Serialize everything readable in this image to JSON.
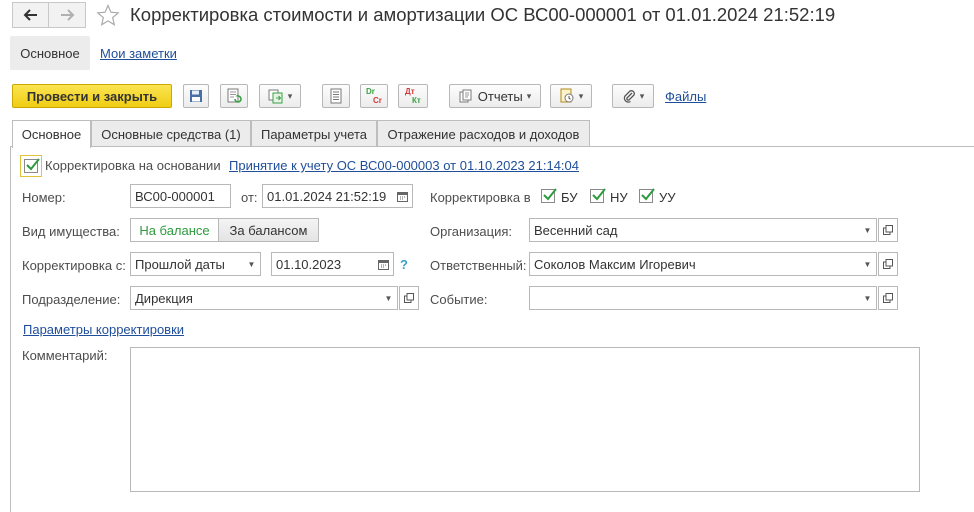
{
  "window": {
    "title": "Корректировка стоимости и амортизации ОС ВС00-000001 от 01.01.2024 21:52:19"
  },
  "icons": {
    "back": "arrow-left-icon",
    "forward": "arrow-right-icon",
    "favorite": "star-icon",
    "save": "floppy-disk-icon",
    "refresh": "refresh-document-icon",
    "create_based": "create-based-on-icon",
    "document_list": "list-icon",
    "dt_ct": "dt-ct-icon",
    "dr_cr": "dr-cr-icon",
    "reports": "reports-icon",
    "attachments": "paperclip-icon",
    "calendar": "calendar-icon",
    "help": "question-icon",
    "open": "open-window-icon"
  },
  "sections": {
    "main": "Основное",
    "notes": "Мои заметки"
  },
  "toolbar": {
    "post_close": "Провести и закрыть",
    "reports": "Отчеты",
    "files": "Файлы",
    "dr_top": "Dr",
    "dr_bottom": "Cr",
    "dt_top": "Дт",
    "dt_bottom": "Кт"
  },
  "tabs": [
    {
      "label": "Основное",
      "active": true
    },
    {
      "label": "Основные средства (1)",
      "active": false
    },
    {
      "label": "Параметры учета",
      "active": false
    },
    {
      "label": "Отражение расходов и доходов",
      "active": false
    }
  ],
  "form": {
    "basis_label": "Корректировка на основании",
    "basis_checked": true,
    "basis_link": "Принятие к учету ОС ВС00-000003 от 01.10.2023 21:14:04",
    "number_label": "Номер:",
    "number_value": "ВС00-000001",
    "date_label": "от:",
    "date_value": "01.01.2024 21:52:19",
    "correction_in_label": "Корректировка в",
    "bu_label": "БУ",
    "nu_label": "НУ",
    "uu_label": "УУ",
    "bu_checked": true,
    "nu_checked": true,
    "uu_checked": true,
    "property_label": "Вид имущества:",
    "on_balance": "На балансе",
    "off_balance": "За балансом",
    "selected_property": "На балансе",
    "org_label": "Организация:",
    "org_value": "Весенний сад",
    "correction_from_label": "Корректировка с:",
    "correction_from_value": "Прошлой даты",
    "correction_date": "01.10.2023",
    "help_mark": "?",
    "responsible_label": "Ответственный:",
    "responsible_value": "Соколов Максим Игоревич",
    "department_label": "Подразделение:",
    "department_value": "Дирекция",
    "event_label": "Событие:",
    "event_value": "",
    "params_link": "Параметры корректировки",
    "comment_label": "Комментарий:",
    "comment_value": ""
  },
  "colors": {
    "primary_button": "#f0cd13",
    "link": "#1f4e9a",
    "check_green": "#2e9a3e",
    "active_segment_text": "#2e9a3e"
  }
}
